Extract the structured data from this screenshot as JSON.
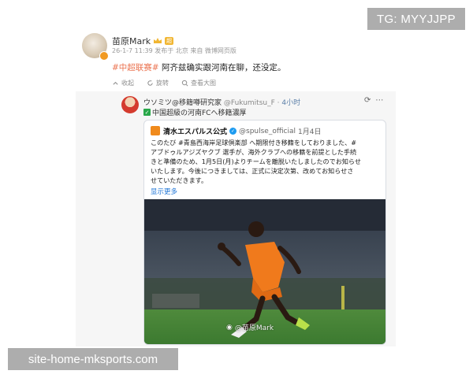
{
  "watermarks": {
    "top_right": "TG: MYYJJPP",
    "bottom_left": "site-home-mksports.com"
  },
  "post": {
    "author": "苗原Mark",
    "level_badge": "超",
    "meta": "26-1-7 11:39 发布于 北京 来自 微博网页版",
    "hashtag": "#中超联赛#",
    "text": " 阿齐兹确实跟河南在聊，还没定。",
    "actions": [
      "收起",
      "旋转",
      "查看大图"
    ]
  },
  "repost": {
    "author": "ウソミツ@移籍噂研究家",
    "handle": "@Fukumitsu_F",
    "separator": " · ",
    "time": "4小时",
    "text": "中国超級の河南FCへ移籍濃厚",
    "embed": {
      "name": "清水エスパルス公式",
      "handle": "@spulse_official",
      "time": "1月4日",
      "lines": [
        "このたび #青島西海岸足球倶楽部 へ期限付き移籍をしておりました、#",
        "アブドゥルアジズヤクブ 選手が、海外クラブへの移籍を前提とした手続",
        "きと準備のため、1月5日(月)よりチームを離脱いたしましたのでお知らせ",
        "いたします。今後につきましては、正式に決定次第、改めてお知らせさ",
        "せていただきます。"
      ],
      "more": "显示更多"
    },
    "photo_credit": "@苗原Mark"
  },
  "icons": {
    "collapse": "collapse-icon",
    "rotate": "rotate-icon",
    "view_large": "view-large-icon",
    "repost_retweet": "retweet-icon",
    "more": "more-icon"
  },
  "colors": {
    "hashtag": "#eb7350",
    "link": "#1d74d6",
    "verified": "#1d9bf0",
    "jersey": "#f07a1c"
  }
}
